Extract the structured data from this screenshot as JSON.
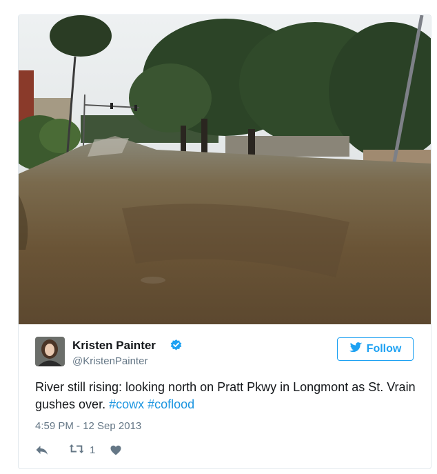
{
  "tweet": {
    "author_name": "Kristen Painter",
    "author_handle": "@KristenPainter",
    "follow_label": "Follow",
    "text_before": "River still rising: looking north on Pratt Pkwy in Longmont as St. Vrain gushes over.",
    "hashtags": [
      "#cowx",
      "#coflood"
    ],
    "timestamp": "4:59 PM - 12 Sep 2013",
    "retweet_count": "1"
  },
  "icons": {
    "verified": "verified-badge-icon",
    "follow": "twitter-bird-icon",
    "reply": "reply-icon",
    "retweet": "retweet-icon",
    "like": "heart-icon"
  },
  "colors": {
    "accent": "#1da1f2",
    "hashtag": "#1b95e0",
    "muted": "#657786",
    "text": "#14171a",
    "border": "#e1e8ed"
  }
}
